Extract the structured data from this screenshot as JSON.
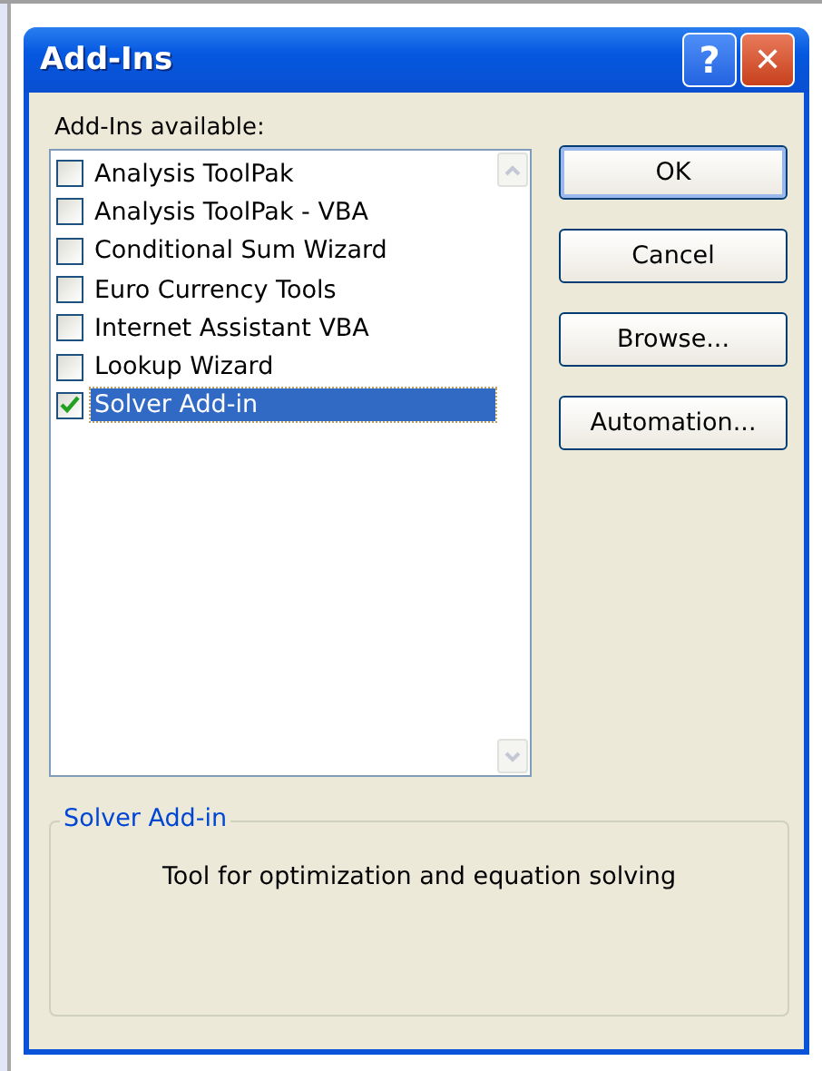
{
  "window": {
    "title": "Add-Ins"
  },
  "title_buttons": [
    {
      "kind": "help",
      "label": "?"
    },
    {
      "kind": "close",
      "label": "✕"
    }
  ],
  "list_label": "Add-Ins available:",
  "addins": [
    {
      "name": "Analysis ToolPak",
      "checked": false,
      "selected": false
    },
    {
      "name": "Analysis ToolPak - VBA",
      "checked": false,
      "selected": false
    },
    {
      "name": "Conditional Sum Wizard",
      "checked": false,
      "selected": false
    },
    {
      "name": "Euro Currency Tools",
      "checked": false,
      "selected": false
    },
    {
      "name": "Internet Assistant VBA",
      "checked": false,
      "selected": false
    },
    {
      "name": "Lookup Wizard",
      "checked": false,
      "selected": false
    },
    {
      "name": "Solver Add-in",
      "checked": true,
      "selected": true
    }
  ],
  "buttons": [
    {
      "label": "OK",
      "default": true
    },
    {
      "label": "Cancel",
      "default": false
    },
    {
      "label": "Browse...",
      "default": false
    },
    {
      "label": "Automation...",
      "default": false
    }
  ],
  "description": {
    "title": "Solver Add-in",
    "text": "Tool for optimization and equation solving"
  }
}
